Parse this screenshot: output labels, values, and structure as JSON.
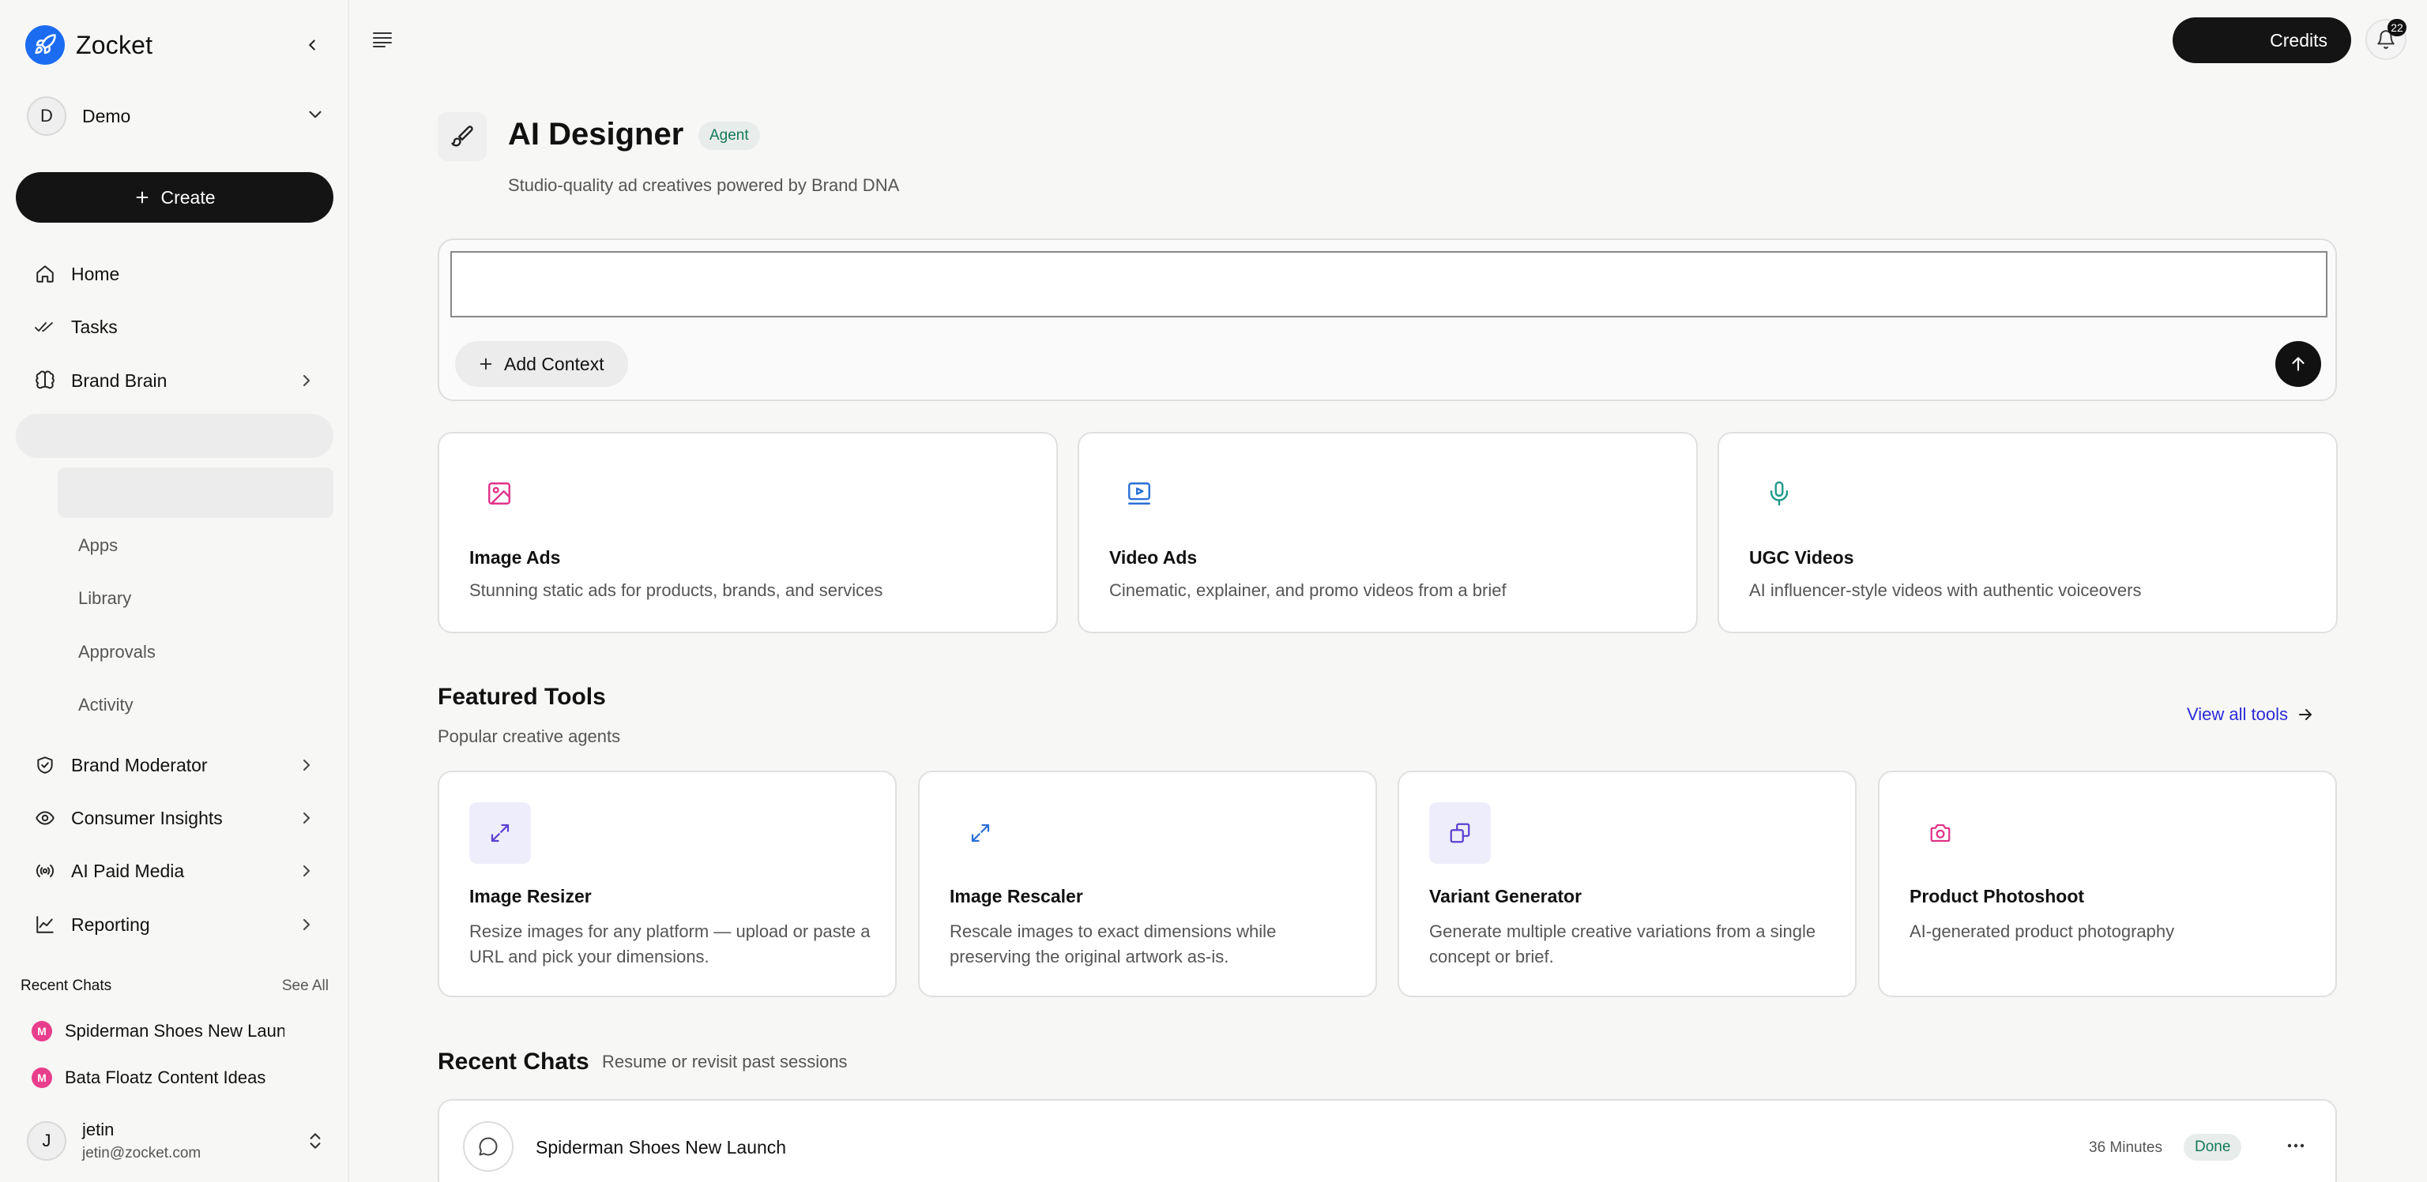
{
  "app": {
    "name": "Zocket"
  },
  "workspace": {
    "initial": "D",
    "name": "Demo"
  },
  "sidebar": {
    "create_label": "Create",
    "nav": [
      {
        "label": "Home"
      },
      {
        "label": "Tasks"
      },
      {
        "label": "Brand Brain"
      },
      {
        "label": "Brand Moderator"
      },
      {
        "label": "Consumer Insights"
      },
      {
        "label": "AI Paid Media"
      },
      {
        "label": "Reporting"
      }
    ],
    "sub_items": [
      "Apps",
      "Library",
      "Approvals",
      "Activity"
    ],
    "recent": {
      "title": "Recent Chats",
      "see_all": "See All",
      "items": [
        {
          "badge": "M",
          "label": "Spiderman Shoes New Launch"
        },
        {
          "badge": "M",
          "label": "Bata Floatz Content Ideas"
        }
      ]
    },
    "user": {
      "initial": "J",
      "name": "jetin",
      "email": "jetin@zocket.com"
    }
  },
  "topbar": {
    "credits_label": "Credits",
    "notifications_count": "22"
  },
  "hero": {
    "title": "AI Designer",
    "badge": "Agent",
    "subtitle": "Studio-quality ad creatives powered by Brand DNA",
    "prompt_value": "",
    "add_context_label": "Add Context"
  },
  "creative_types": [
    {
      "icon": "image-icon",
      "title": "Image Ads",
      "desc": "Stunning static ads for products, brands, and services"
    },
    {
      "icon": "video-icon",
      "title": "Video Ads",
      "desc": "Cinematic, explainer, and promo videos from a brief"
    },
    {
      "icon": "microphone-icon",
      "title": "UGC Videos",
      "desc": "AI influencer-style videos with authentic voiceovers"
    }
  ],
  "featured": {
    "title": "Featured Tools",
    "subtitle": "Popular creative agents",
    "view_all": "View all tools",
    "tools": [
      {
        "icon": "resize-icon",
        "title": "Image Resizer",
        "desc": "Resize images for any platform — upload or paste a URL and pick your dimensions."
      },
      {
        "icon": "rescale-icon",
        "title": "Image Rescaler",
        "desc": "Rescale images to exact dimensions while preserving the original artwork as-is."
      },
      {
        "icon": "variants-icon",
        "title": "Variant Generator",
        "desc": "Generate multiple creative variations from a single concept or brief."
      },
      {
        "icon": "camera-icon",
        "title": "Product Photoshoot",
        "desc": "AI-generated product photography"
      }
    ]
  },
  "recent_chats": {
    "title": "Recent Chats",
    "subtitle": "Resume or revisit past sessions",
    "items": [
      {
        "name": "Spiderman Shoes New Launch",
        "time": "36 Minutes",
        "status": "Done"
      }
    ]
  },
  "colors": {
    "brand_blue": "#1c6cf2",
    "badge_green": "#12795a",
    "link_blue": "#2b2bd6",
    "image_pink": "#e0338a",
    "video_blue": "#2a6fd6",
    "ugc_teal": "#1f9a8a",
    "tool_purple": "#5b3fd0"
  }
}
